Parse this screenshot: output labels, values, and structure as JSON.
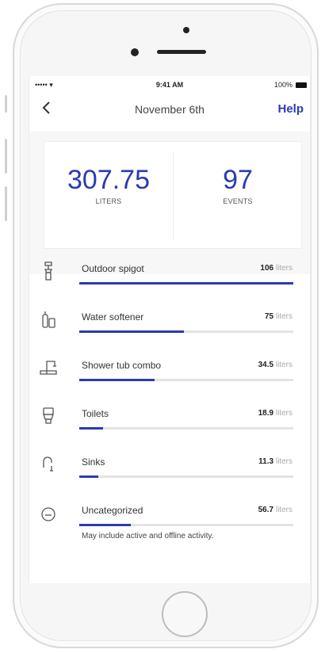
{
  "status": {
    "signal": "••••• ▾",
    "time": "9:41 AM",
    "battery": "100%"
  },
  "nav": {
    "title": "November 6th",
    "help": "Help",
    "back_icon": "chevron-left-icon"
  },
  "summary": {
    "liters": {
      "value": "307.75",
      "label": "LITERS"
    },
    "events": {
      "value": "97",
      "label": "EVENTS"
    }
  },
  "accent_color": "#2b3bb0",
  "items": [
    {
      "name": "Outdoor spigot",
      "amount": "106",
      "unit": "liters",
      "fraction": 1.0,
      "icon": "spigot-icon"
    },
    {
      "name": "Water softener",
      "amount": "75",
      "unit": "liters",
      "fraction": 0.49,
      "icon": "water-softener-icon"
    },
    {
      "name": "Shower tub combo",
      "amount": "34.5",
      "unit": "liters",
      "fraction": 0.35,
      "icon": "shower-tub-icon"
    },
    {
      "name": "Toilets",
      "amount": "18.9",
      "unit": "liters",
      "fraction": 0.11,
      "icon": "toilet-icon"
    },
    {
      "name": "Sinks",
      "amount": "11.3",
      "unit": "liters",
      "fraction": 0.09,
      "icon": "sink-faucet-icon"
    },
    {
      "name": "Uncategorized",
      "amount": "56.7",
      "unit": "liters",
      "fraction": 0.24,
      "icon": "droplet-icon",
      "note": "May include active and offline activity."
    }
  ]
}
